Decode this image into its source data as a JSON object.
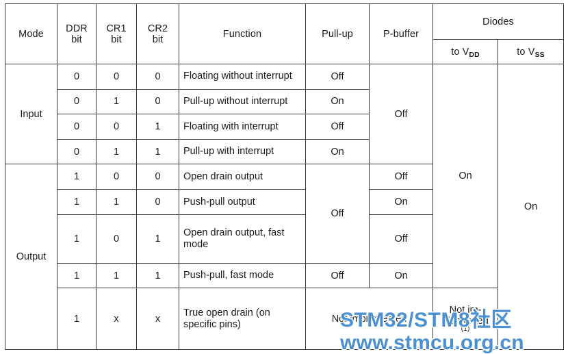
{
  "table": {
    "header": {
      "mode": "Mode",
      "ddr_bit_line1": "DDR",
      "ddr_bit_line2": "bit",
      "cr1_bit_line1": "CR1",
      "cr1_bit_line2": "bit",
      "cr2_bit_line1": "CR2",
      "cr2_bit_line2": "bit",
      "function": "Function",
      "pullup": "Pull-up",
      "pbuffer": "P-buffer",
      "diodes": "Diodes",
      "to_vdd_prefix": "to V",
      "to_vdd_sub": "DD",
      "to_vss_prefix": "to V",
      "to_vss_sub": "SS"
    },
    "mode_groups": {
      "input": "Input",
      "output": "Output"
    },
    "rows": [
      {
        "ddr": "0",
        "cr1": "0",
        "cr2": "0",
        "function": "Floating without interrupt",
        "pullup": "Off"
      },
      {
        "ddr": "0",
        "cr1": "1",
        "cr2": "0",
        "function": "Pull-up without interrupt",
        "pullup": "On"
      },
      {
        "ddr": "0",
        "cr1": "0",
        "cr2": "1",
        "function": "Floating with interrupt",
        "pullup": "Off"
      },
      {
        "ddr": "0",
        "cr1": "1",
        "cr2": "1",
        "function": "Pull-up with interrupt",
        "pullup": "On"
      },
      {
        "ddr": "1",
        "cr1": "0",
        "cr2": "0",
        "function": "Open drain output",
        "pbuffer": "Off"
      },
      {
        "ddr": "1",
        "cr1": "1",
        "cr2": "0",
        "function": "Push-pull output",
        "pbuffer": "On"
      },
      {
        "ddr": "1",
        "cr1": "0",
        "cr2": "1",
        "function": "Open drain output, fast mode",
        "pbuffer": "Off"
      },
      {
        "ddr": "1",
        "cr1": "1",
        "cr2": "1",
        "function": "Push-pull, fast mode",
        "pullup": "Off",
        "pbuffer": "On"
      },
      {
        "ddr": "1",
        "cr1": "x",
        "cr2": "x",
        "function": "True open drain (on specific pins)",
        "not_implemented": "Not implemented",
        "diode_vdd_line1": "Not im-",
        "diode_vdd_line2": "plemented",
        "diode_vdd_footnote": "(1)"
      }
    ],
    "merged": {
      "input_pbuffer": "Off",
      "output_pullup": "Off",
      "diode_vdd": "On",
      "diode_vss": "On"
    }
  },
  "watermark": {
    "line1": "STM32/STM8社区",
    "line2": "www.stmcu.org.cn",
    "color": "#4a90d2"
  }
}
